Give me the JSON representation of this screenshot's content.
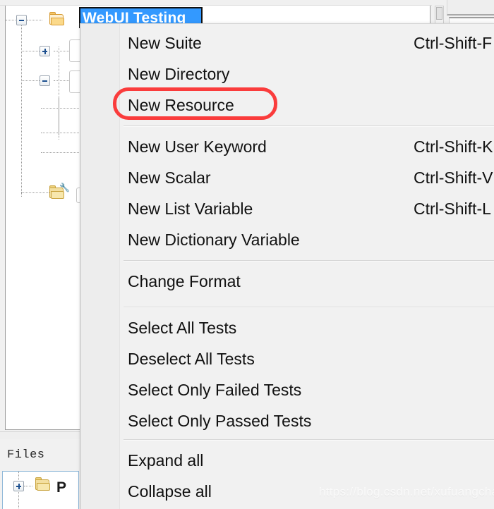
{
  "tree": {
    "selected_node": "WebUI Testing",
    "nodes": [
      {
        "label": "WebUI Testing",
        "expander": "minus",
        "icon": "folder-open-icon"
      },
      {
        "label": "",
        "expander": "plus",
        "icon": "none"
      },
      {
        "label": "",
        "expander": "minus",
        "icon": "none"
      },
      {
        "label": "",
        "expander": "none",
        "icon": "resource-folder-icon"
      }
    ]
  },
  "context_menu": {
    "groups": [
      {
        "items": [
          {
            "label": "New Suite",
            "accel": "Ctrl-Shift-F"
          },
          {
            "label": "New Directory",
            "accel": ""
          },
          {
            "label": "New Resource",
            "accel": ""
          }
        ]
      },
      {
        "items": [
          {
            "label": "New User Keyword",
            "accel": "Ctrl-Shift-K"
          },
          {
            "label": "New Scalar",
            "accel": "Ctrl-Shift-V"
          },
          {
            "label": "New List Variable",
            "accel": "Ctrl-Shift-L"
          },
          {
            "label": "New Dictionary Variable",
            "accel": ""
          }
        ]
      },
      {
        "items": [
          {
            "label": "Change Format",
            "accel": ""
          }
        ]
      },
      {
        "items": [
          {
            "label": "Select All Tests",
            "accel": ""
          },
          {
            "label": "Deselect All Tests",
            "accel": ""
          },
          {
            "label": "Select Only Failed Tests",
            "accel": ""
          },
          {
            "label": "Select Only Passed Tests",
            "accel": ""
          }
        ]
      },
      {
        "items": [
          {
            "label": "Expand all",
            "accel": ""
          },
          {
            "label": "Collapse all",
            "accel": ""
          }
        ]
      }
    ]
  },
  "annotation": {
    "target_item": "New Resource",
    "color": "#fa3c3c",
    "shape": "rounded-rectangle"
  },
  "files_panel": {
    "tab_label": "Files",
    "first_node_label": "P",
    "first_node_icon": "folder-closed-icon",
    "first_node_expander": "plus"
  },
  "watermark": {
    "text": "https://blog.csdn.net/xufuangchao"
  },
  "colors": {
    "selection_blue": "#3399ff",
    "menu_background": "#f1f1f1",
    "annotation_red": "#fa3c3c",
    "folder_orange": "#fbd98a"
  }
}
